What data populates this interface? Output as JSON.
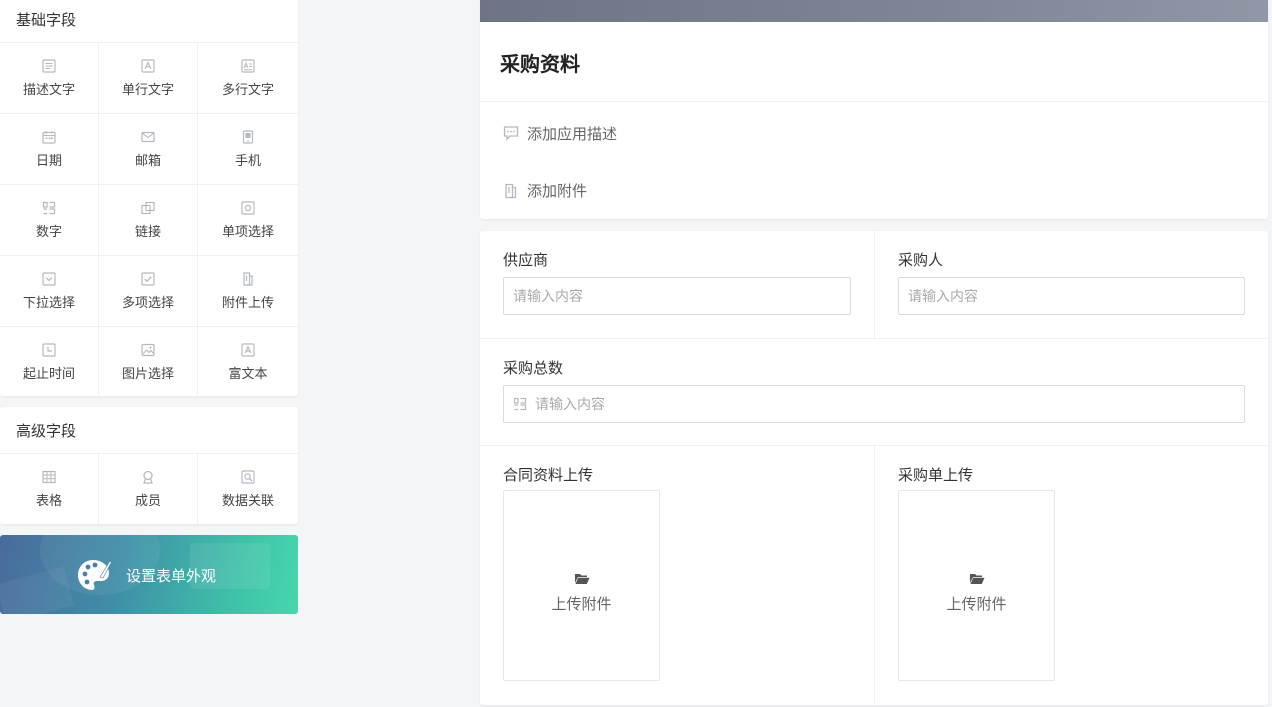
{
  "basic_section": {
    "title": "基础字段",
    "items": [
      {
        "label": "描述文字",
        "icon": "description-icon"
      },
      {
        "label": "单行文字",
        "icon": "single-line-text-icon"
      },
      {
        "label": "多行文字",
        "icon": "multi-line-text-icon"
      },
      {
        "label": "日期",
        "icon": "calendar-icon"
      },
      {
        "label": "邮箱",
        "icon": "mail-icon"
      },
      {
        "label": "手机",
        "icon": "phone-icon"
      },
      {
        "label": "数字",
        "icon": "number-icon"
      },
      {
        "label": "链接",
        "icon": "link-icon"
      },
      {
        "label": "单项选择",
        "icon": "radio-icon"
      },
      {
        "label": "下拉选择",
        "icon": "dropdown-icon"
      },
      {
        "label": "多项选择",
        "icon": "checkbox-icon"
      },
      {
        "label": "附件上传",
        "icon": "attachment-icon"
      },
      {
        "label": "起止时间",
        "icon": "time-range-icon"
      },
      {
        "label": "图片选择",
        "icon": "image-icon"
      },
      {
        "label": "富文本",
        "icon": "rich-text-icon"
      }
    ]
  },
  "advanced_section": {
    "title": "高级字段",
    "items": [
      {
        "label": "表格",
        "icon": "table-icon"
      },
      {
        "label": "成员",
        "icon": "member-icon"
      },
      {
        "label": "数据关联",
        "icon": "data-link-icon"
      }
    ]
  },
  "banner": {
    "text": "设置表单外观",
    "icon": "palette-icon"
  },
  "form": {
    "title": "采购资料",
    "add_description": "添加应用描述",
    "add_attachment": "添加附件",
    "fields": {
      "supplier": {
        "label": "供应商",
        "placeholder": "请输入内容"
      },
      "purchaser": {
        "label": "采购人",
        "placeholder": "请输入内容"
      },
      "total": {
        "label": "采购总数",
        "placeholder": "请输入内容"
      },
      "contract_upload": {
        "label": "合同资料上传",
        "button": "上传附件"
      },
      "order_upload": {
        "label": "采购单上传",
        "button": "上传附件"
      }
    }
  },
  "colors": {
    "cover": "#7e8796",
    "banner_start": "#4a6b9c",
    "banner_end": "#46d7ae",
    "icon_gray": "#b4b9c1"
  }
}
